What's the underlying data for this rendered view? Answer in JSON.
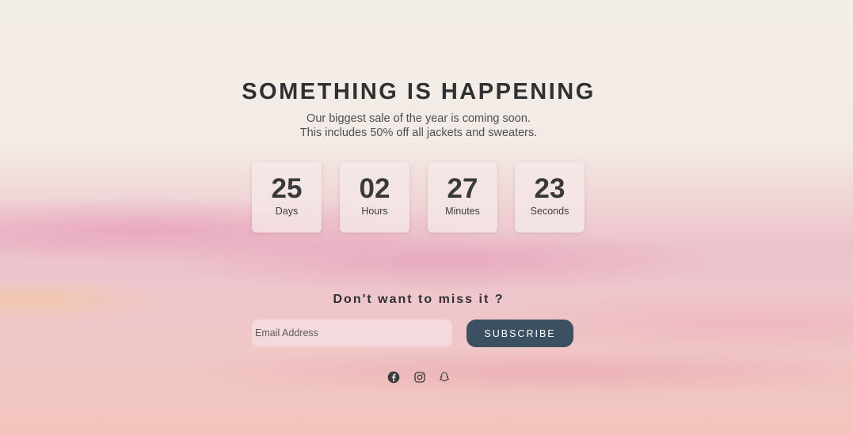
{
  "hero": {
    "title": "SOMETHING IS HAPPENING",
    "subtitle_line1": "Our biggest sale of the year is coming soon.",
    "subtitle_line2": "This includes 50% off all jackets and sweaters."
  },
  "countdown": [
    {
      "value": "25",
      "label": "Days"
    },
    {
      "value": "02",
      "label": "Hours"
    },
    {
      "value": "27",
      "label": "Minutes"
    },
    {
      "value": "23",
      "label": "Seconds"
    }
  ],
  "newsletter": {
    "heading": "Don't want to miss it ?",
    "email_placeholder": "Email Address",
    "subscribe_label": "SUBSCRIBE"
  },
  "social": [
    {
      "icon": "facebook-icon"
    },
    {
      "icon": "instagram-icon"
    },
    {
      "icon": "snapchat-icon"
    }
  ],
  "colors": {
    "button": "#3b5060",
    "text": "#2f3032"
  }
}
